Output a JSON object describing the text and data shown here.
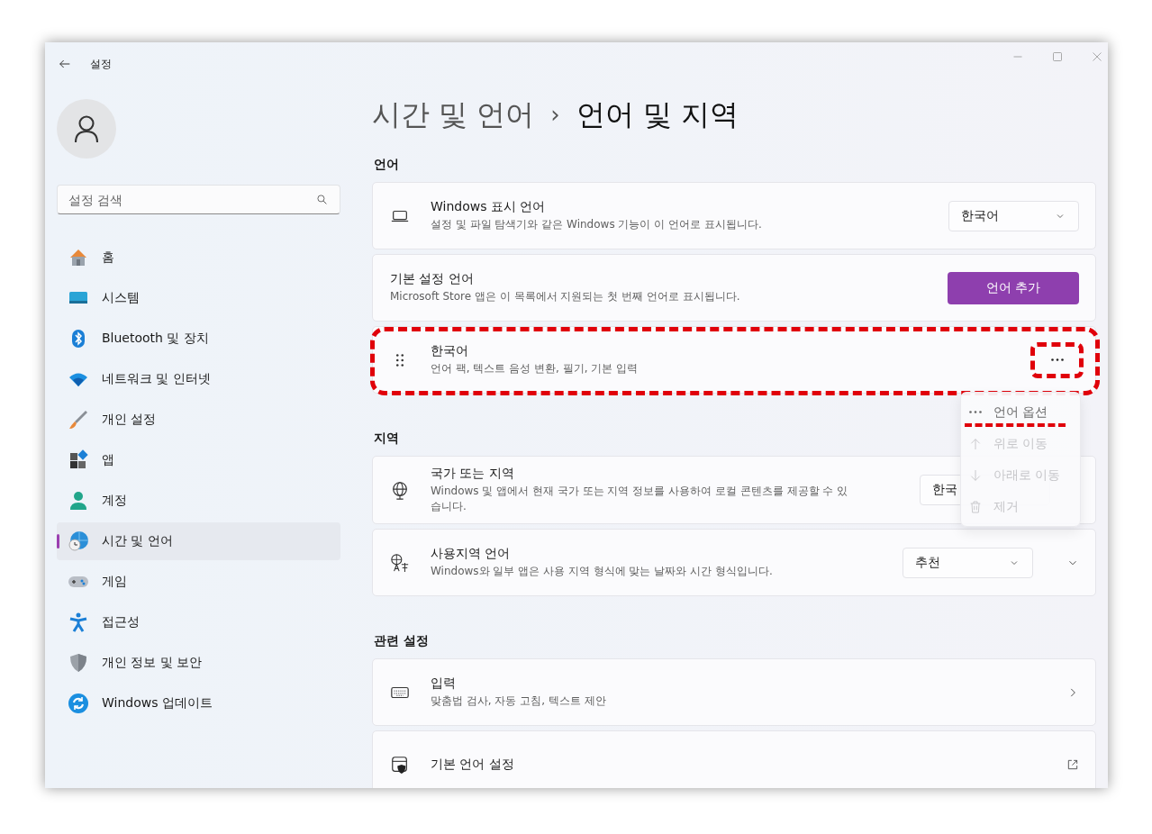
{
  "window": {
    "title": "설정"
  },
  "sidebar": {
    "search": {
      "placeholder": "설정 검색"
    },
    "items": [
      {
        "label": "홈",
        "selected": false
      },
      {
        "label": "시스템",
        "selected": false
      },
      {
        "label": "Bluetooth 및 장치",
        "selected": false
      },
      {
        "label": "네트워크 및 인터넷",
        "selected": false
      },
      {
        "label": "개인 설정",
        "selected": false
      },
      {
        "label": "앱",
        "selected": false
      },
      {
        "label": "계정",
        "selected": false
      },
      {
        "label": "시간 및 언어",
        "selected": true
      },
      {
        "label": "게임",
        "selected": false
      },
      {
        "label": "접근성",
        "selected": false
      },
      {
        "label": "개인 정보 및 보안",
        "selected": false
      },
      {
        "label": "Windows 업데이트",
        "selected": false
      }
    ]
  },
  "breadcrumb": {
    "parent": "시간 및 언어",
    "separator": "›",
    "current": "언어 및 지역"
  },
  "sections": [
    {
      "heading": "언어",
      "cards": [
        {
          "kind": "dropdown",
          "title": "Windows 표시 언어",
          "description": "설정 및 파일 탐색기와 같은 Windows 기능이 이 언어로 표시됩니다.",
          "value": "한국어"
        },
        {
          "kind": "button",
          "title": "기본 설정 언어",
          "description": "Microsoft Store 앱은 이 목록에서 지원되는 첫 번째 언어로 표시됩니다.",
          "button": "언어 추가"
        },
        {
          "kind": "language",
          "title": "한국어",
          "description": "언어 팩, 텍스트 음성 변환, 필기, 기본 입력",
          "highlighted": true
        }
      ]
    },
    {
      "heading": "지역",
      "cards": [
        {
          "kind": "dropdown",
          "title": "국가 또는 지역",
          "description": "Windows 및 앱에서 현재 국가 또는 지역 정보를 사용하여 로컬 콘텐츠를 제공할 수 있습니다.",
          "value": "한국"
        },
        {
          "kind": "expandable",
          "title": "사용지역 언어",
          "description": "Windows와 일부 앱은 사용 지역 형식에 맞는 날짜와 시간 형식입니다.",
          "value": "추천"
        }
      ]
    },
    {
      "heading": "관련 설정",
      "cards": [
        {
          "kind": "link",
          "title": "입력",
          "description": "맞춤법 검사, 자동 고침, 텍스트 제안"
        },
        {
          "kind": "external",
          "title": "기본 언어 설정"
        }
      ]
    }
  ],
  "context_menu": {
    "items": [
      {
        "label": "언어 옵션",
        "disabled": false,
        "highlighted": true
      },
      {
        "label": "위로 이동",
        "disabled": true,
        "highlighted": false
      },
      {
        "label": "아래로 이동",
        "disabled": true,
        "highlighted": false
      },
      {
        "label": "제거",
        "disabled": true,
        "highlighted": false
      }
    ]
  }
}
